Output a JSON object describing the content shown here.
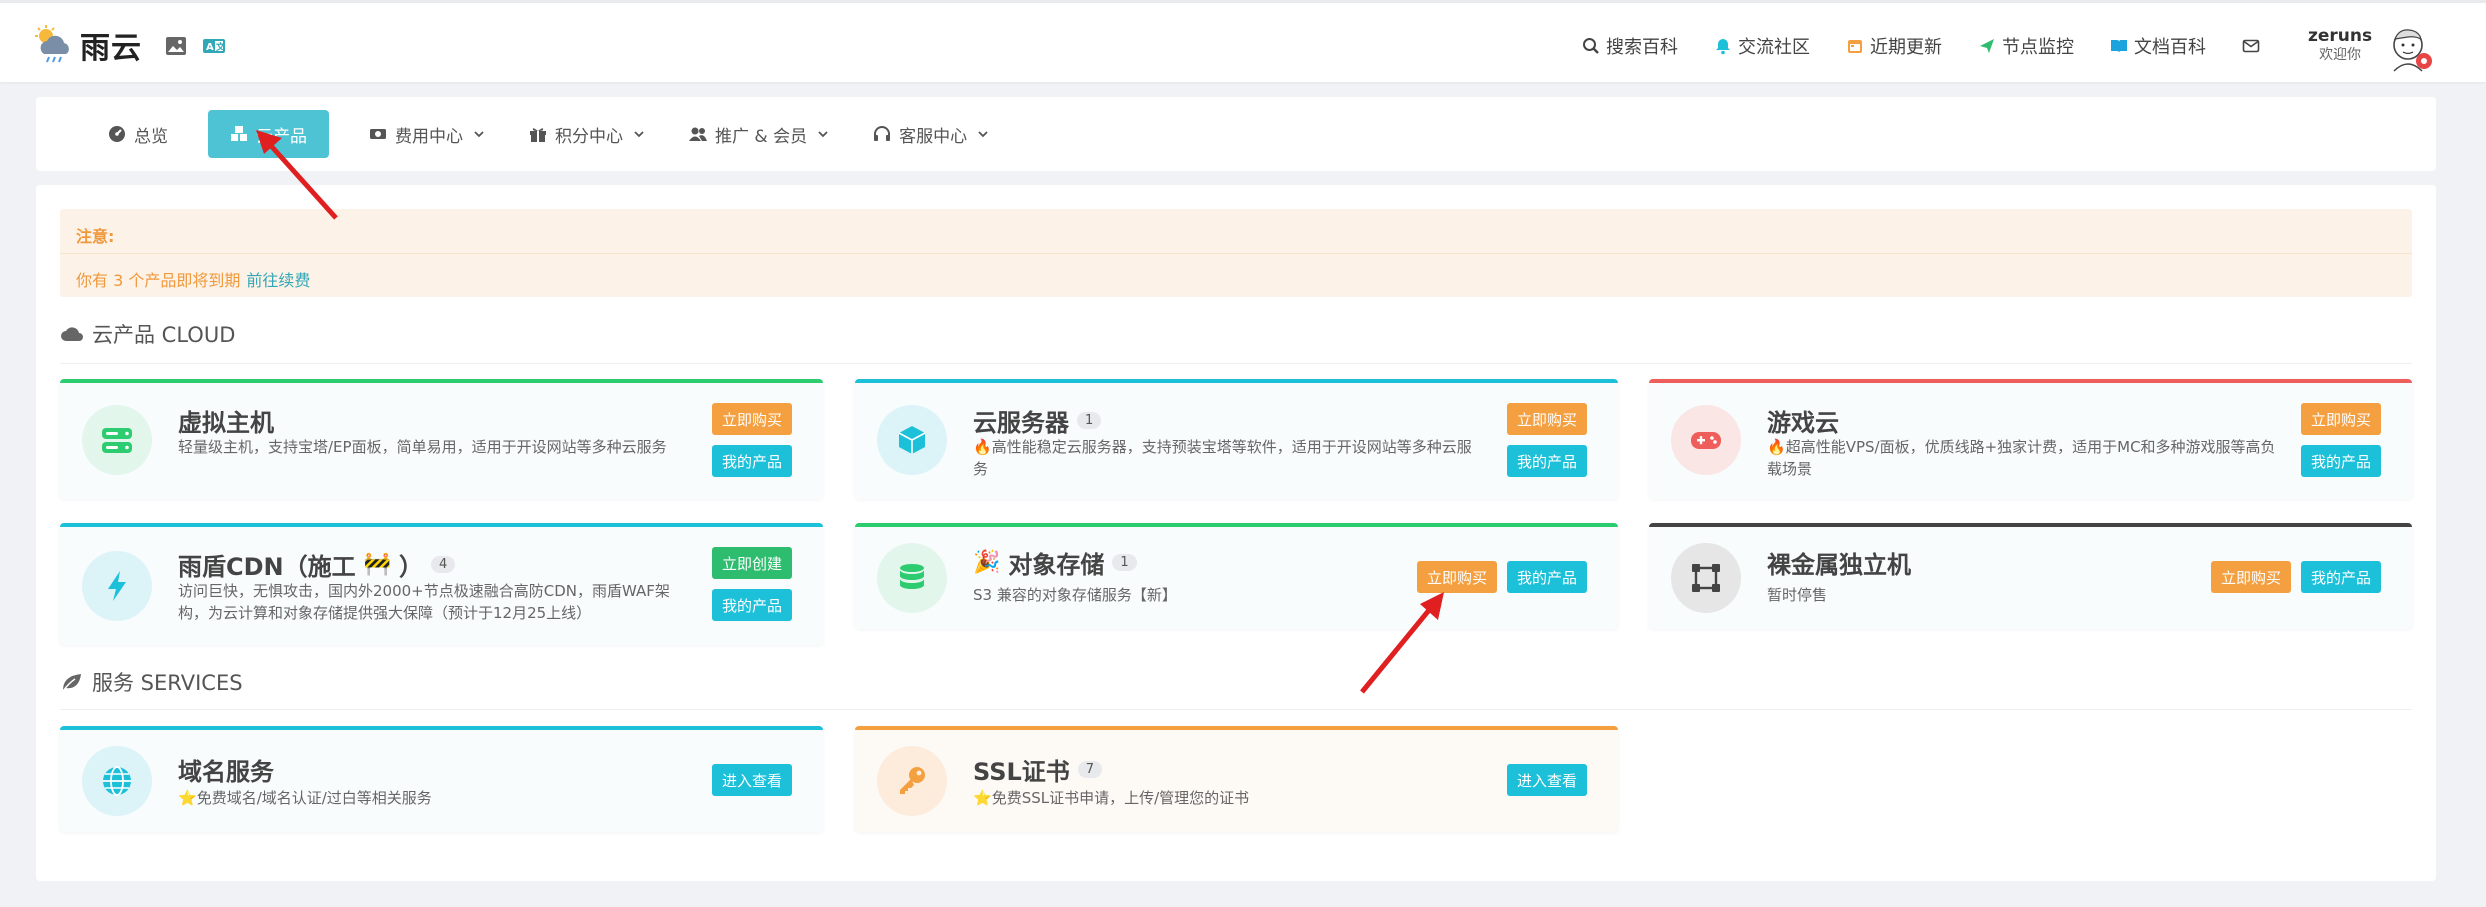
{
  "header": {
    "logo_text": "雨云",
    "nav": [
      {
        "icon": "search-icon",
        "label": "搜索百科"
      },
      {
        "icon": "bell-icon",
        "label": "交流社区"
      },
      {
        "icon": "calendar-icon",
        "label": "近期更新"
      },
      {
        "icon": "send-icon",
        "label": "节点监控"
      },
      {
        "icon": "book-icon",
        "label": "文档百科"
      }
    ],
    "username": "zeruns",
    "welcome": "欢迎你"
  },
  "tabs": [
    {
      "label": "总览"
    },
    {
      "label": "云产品"
    },
    {
      "label": "费用中心"
    },
    {
      "label": "积分中心"
    },
    {
      "label": "推广 & 会员"
    },
    {
      "label": "客服中心"
    }
  ],
  "alert": {
    "title": "注意:",
    "message": "你有 3 个产品即将到期",
    "link": "前往续费"
  },
  "cloud_section": {
    "title": "云产品 CLOUD"
  },
  "services_section": {
    "title": "服务 SERVICES"
  },
  "products": [
    {
      "name": "虚拟主机",
      "count": "",
      "desc": "轻量级主机，支持宝塔/EP面板，简单易用，适用于开设网站等多种云服务",
      "btn1": "立即购买",
      "btn2": "我的产品"
    },
    {
      "name": "云服务器",
      "count": "1",
      "desc": "高性能稳定云服务器，支持预装宝塔等软件，适用于开设网站等多种云服务",
      "btn1": "立即购买",
      "btn2": "我的产品"
    },
    {
      "name": "游戏云",
      "count": "",
      "desc": "超高性能VPS/面板，优质线路+独家计费，适用于MC和多种游戏服等高负载场景",
      "btn1": "立即购买",
      "btn2": "我的产品"
    },
    {
      "name": "雨盾CDN（施工",
      "name_suffix": "）",
      "count": "4",
      "desc": "访问巨快，无惧攻击，国内外2000+节点极速融合高防CDN，雨盾WAF架构，为云计算和对象存储提供强大保障（预计于12月25上线）",
      "btn1": "立即创建",
      "btn2": "我的产品"
    },
    {
      "name": "对象存储",
      "count": "1",
      "desc": "S3 兼容的对象存储服务【新】",
      "btn1": "立即购买",
      "btn2": "我的产品"
    },
    {
      "name": "裸金属独立机",
      "count": "",
      "desc": "暂时停售",
      "btn1": "立即购买",
      "btn2": "我的产品"
    }
  ],
  "services": [
    {
      "name": "域名服务",
      "count": "",
      "desc": "免费域名/域名认证/过白等相关服务",
      "btn": "进入查看"
    },
    {
      "name": "SSL证书",
      "count": "7",
      "desc": "免费SSL证书申请，上传/管理您的证书",
      "btn": "进入查看"
    }
  ],
  "colors": {
    "accent": "#4ec3d4",
    "orange": "#f4a041",
    "cyan": "#1cc0d9",
    "green": "#2ebd6f",
    "arrow": "#e02020"
  }
}
